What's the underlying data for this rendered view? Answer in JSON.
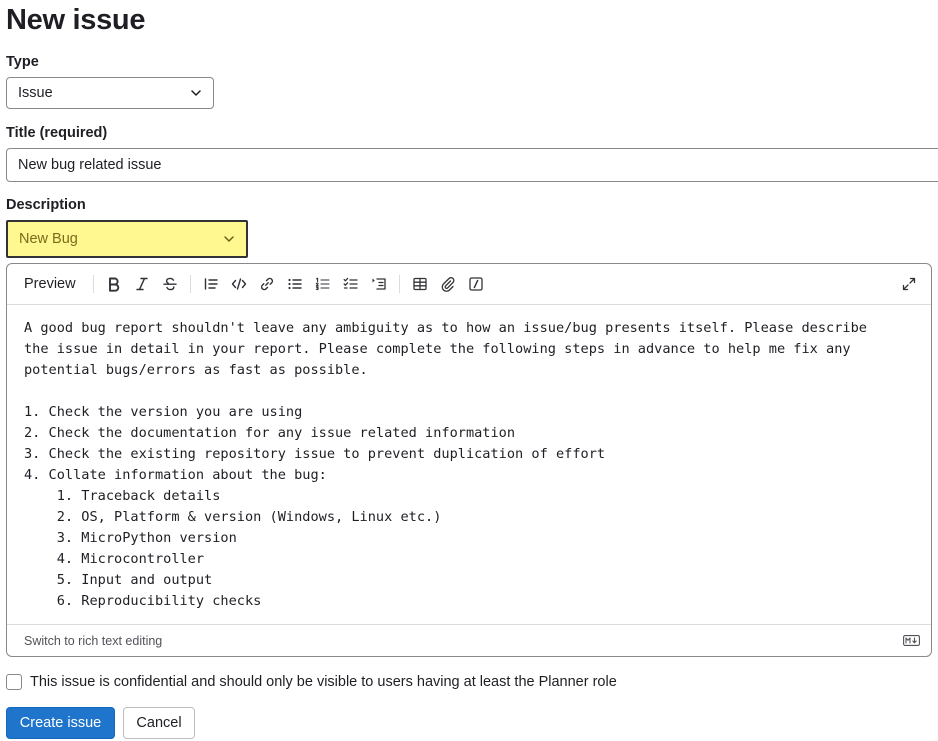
{
  "page": {
    "title": "New issue"
  },
  "type": {
    "label": "Type",
    "selected": "Issue"
  },
  "title_field": {
    "label": "Title (required)",
    "value": "New bug related issue"
  },
  "description": {
    "label": "Description",
    "template_selected": "New Bug",
    "toolbar": {
      "preview_label": "Preview",
      "icons": [
        "bold-icon",
        "italic-icon",
        "strikethrough-icon",
        "quote-icon",
        "code-icon",
        "link-icon",
        "bullet-list-icon",
        "numbered-list-icon",
        "task-list-icon",
        "collapsible-section-icon",
        "table-icon",
        "attachment-icon",
        "slash-command-icon",
        "fullscreen-icon"
      ]
    },
    "body": "A good bug report shouldn't leave any ambiguity as to how an issue/bug presents itself. Please describe\nthe issue in detail in your report. Please complete the following steps in advance to help me fix any\npotential bugs/errors as fast as possible.\n\n1. Check the version you are using\n2. Check the documentation for any issue related information\n3. Check the existing repository issue to prevent duplication of effort\n4. Collate information about the bug:\n    1. Traceback details\n    2. OS, Platform & version (Windows, Linux etc.)\n    3. MicroPython version\n    4. Microcontroller\n    5. Input and output\n    6. Reproducibility checks",
    "footer_link": "Switch to rich text editing",
    "markdown_icon": "markdown-icon"
  },
  "confidential": {
    "label": "This issue is confidential and should only be visible to users having at least the Planner role",
    "checked": false
  },
  "actions": {
    "create_label": "Create issue",
    "cancel_label": "Cancel"
  },
  "colors": {
    "primary": "#1f75cb",
    "highlight": "#fff890",
    "border": "#89888d",
    "text": "#1f1e24"
  }
}
